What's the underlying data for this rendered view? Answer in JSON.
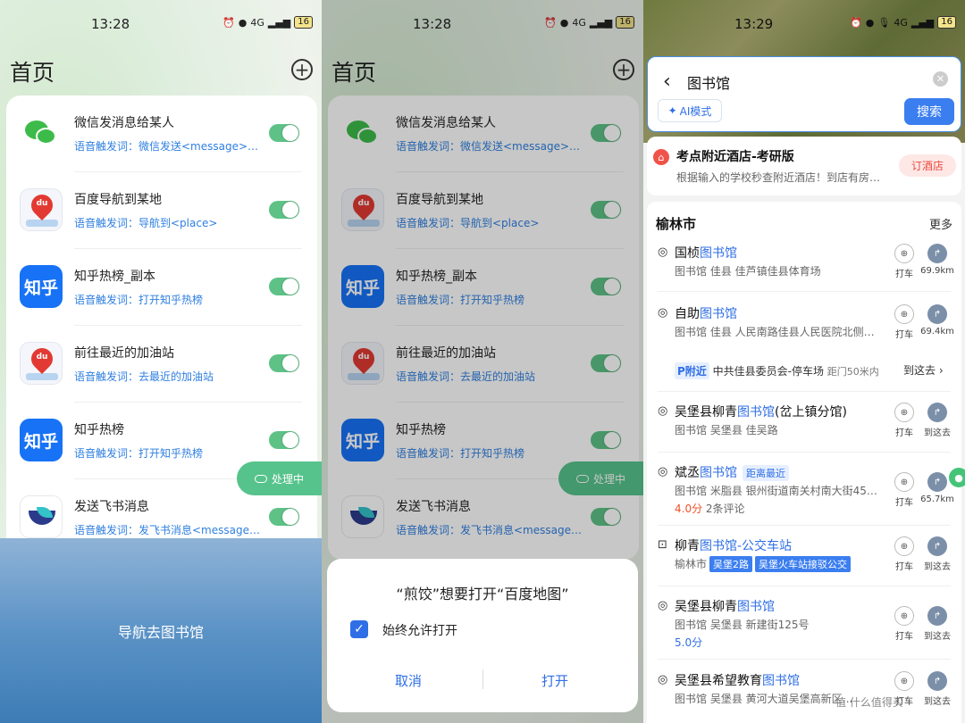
{
  "status": {
    "time1": "13:28",
    "time2": "13:28",
    "time3": "13:29",
    "battery": "16",
    "network": "4G"
  },
  "home": {
    "title": "首页",
    "items": [
      {
        "title": "微信发消息给某人",
        "trigger": "语音触发词：微信发送<message>给<contact>"
      },
      {
        "title": "百度导航到某地",
        "trigger": "语音触发词：导航到<place>"
      },
      {
        "title": "知乎热榜_副本",
        "trigger": "语音触发词：打开知乎热榜"
      },
      {
        "title": "前往最近的加油站",
        "trigger": "语音触发词：去最近的加油站"
      },
      {
        "title": "知乎热榜",
        "trigger": "语音触发词：打开知乎热榜"
      },
      {
        "title": "发送飞书消息",
        "trigger": "语音触发词：发飞书消息<message>给<contact>"
      }
    ],
    "zhihu_logo": "知乎",
    "baidu_logo": "du",
    "processing": "处理中",
    "nav_text": "导航去图书馆"
  },
  "dialog": {
    "title": "“煎饺”想要打开“百度地图”",
    "checkbox": "始终允许打开",
    "cancel": "取消",
    "open": "打开"
  },
  "map": {
    "query": "图书馆",
    "ai_mode": "AI模式",
    "search": "搜索",
    "ad": {
      "title": "考点附近酒店-考研版",
      "desc": "根据输入的学校秒查附近酒店！到店有房…",
      "button": "订酒店"
    },
    "city": "榆林市",
    "more": "更多",
    "taxi": "打车",
    "go_here": "到这去",
    "results": [
      {
        "pre": "国桢",
        "hl": "图书馆",
        "post": "",
        "desc": "图书馆  佳县  佳芦镇佳县体育场",
        "dist": "69.9km"
      },
      {
        "pre": "自助",
        "hl": "图书馆",
        "post": "",
        "desc": "图书馆  佳县  人民南路佳县人民医院北侧…",
        "dist": "69.4km"
      },
      {
        "pre": "吴堡县柳青",
        "hl": "图书馆",
        "post": "(岔上镇分馆)",
        "desc": "图书馆  吴堡县  佳吴路"
      },
      {
        "pre": "斌丞",
        "hl": "图书馆",
        "post": "",
        "tag": "距离最近",
        "desc": "图书馆  米脂县  银州街道南关村南大街45…",
        "rating": "4.0分",
        "reviews": "2条评论",
        "dist": "65.7km"
      },
      {
        "pre": "柳青",
        "hl": "图书馆-公交车站",
        "post": "",
        "desc": "榆林市",
        "lines": [
          "吴堡2路",
          "吴堡火车站接驳公交"
        ]
      },
      {
        "pre": "吴堡县柳青",
        "hl": "图书馆",
        "post": "",
        "desc": "图书馆  吴堡县  新建街125号",
        "rating": "5.0分"
      },
      {
        "pre": "吴堡县希望教育",
        "hl": "图书馆",
        "post": "",
        "desc": "图书馆  吴堡县  黄河大道吴堡高新区…"
      }
    ],
    "parking": {
      "tag": "P附近",
      "name": "中共佳县委员会-停车场",
      "dist": "距门50米内",
      "go": "到这去 ›"
    }
  },
  "watermark": "值 什么值得买"
}
